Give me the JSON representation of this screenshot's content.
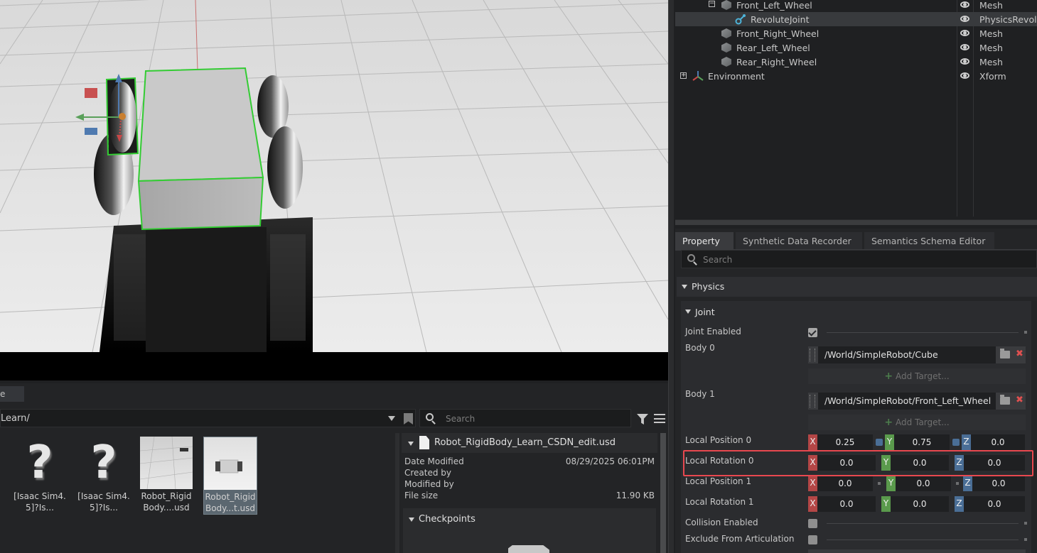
{
  "stage": {
    "rows": [
      {
        "name": "Front_Left_Wheel",
        "type": "Mesh"
      },
      {
        "name": "RevoluteJoint",
        "type": "PhysicsRevolu"
      },
      {
        "name": "Front_Right_Wheel",
        "type": "Mesh"
      },
      {
        "name": "Rear_Left_Wheel",
        "type": "Mesh"
      },
      {
        "name": "Rear_Right_Wheel",
        "type": "Mesh"
      },
      {
        "name": "Environment",
        "type": "Xform"
      }
    ]
  },
  "property": {
    "tabs": [
      "Property",
      "Synthetic Data Recorder",
      "Semantics Schema Editor"
    ],
    "search_placeholder": "Search",
    "physics_label": "Physics",
    "joint_label": "Joint",
    "joint_enabled_label": "Joint Enabled",
    "body0_label": "Body 0",
    "body0_path": "/World/SimpleRobot/Cube",
    "body1_label": "Body 1",
    "body1_path": "/World/SimpleRobot/Front_Left_Wheel",
    "add_target": "Add Target...",
    "collision_label": "Collision Enabled",
    "exclude_label": "Exclude From Articulation",
    "axis": {
      "x": "X",
      "y": "Y",
      "z": "Z"
    },
    "local_position_0": {
      "label": "Local Position 0",
      "x": "0.25",
      "y": "0.75",
      "z": "0.0"
    },
    "local_rotation_0": {
      "label": "Local Rotation 0",
      "x": "0.0",
      "y": "0.0",
      "z": "0.0"
    },
    "local_position_1": {
      "label": "Local Position 1",
      "x": "0.0",
      "y": "0.0",
      "z": "0.0"
    },
    "local_rotation_1": {
      "label": "Local Rotation 1",
      "x": "0.0",
      "y": "0.0",
      "z": "0.0"
    }
  },
  "content_browser": {
    "tab_label": "e",
    "path": "Learn/",
    "search_placeholder": "Search",
    "files": [
      {
        "line1": "[Isaac Sim4.",
        "line2": "5]?Is..."
      },
      {
        "line1": "[Isaac Sim4.",
        "line2": "5]?Is..."
      },
      {
        "line1": "Robot_Rigid",
        "line2": "Body....usd"
      },
      {
        "line1": "Robot_Rigid",
        "line2": "Body...t.usd"
      }
    ],
    "details": {
      "filename": "Robot_RigidBody_Learn_CSDN_edit.usd",
      "date_modified_label": "Date Modified",
      "date_modified": "08/29/2025 06:01PM",
      "created_by_label": "Created by",
      "modified_by_label": "Modified by",
      "file_size_label": "File size",
      "file_size": "11.90 KB",
      "checkpoints_label": "Checkpoints"
    }
  },
  "colors": {
    "selection_outline": "#2ecc2e",
    "highlight": "#e8484f",
    "axis_x": "#b44646",
    "axis_y": "#5a9a4c",
    "axis_z": "#4a6e96"
  }
}
